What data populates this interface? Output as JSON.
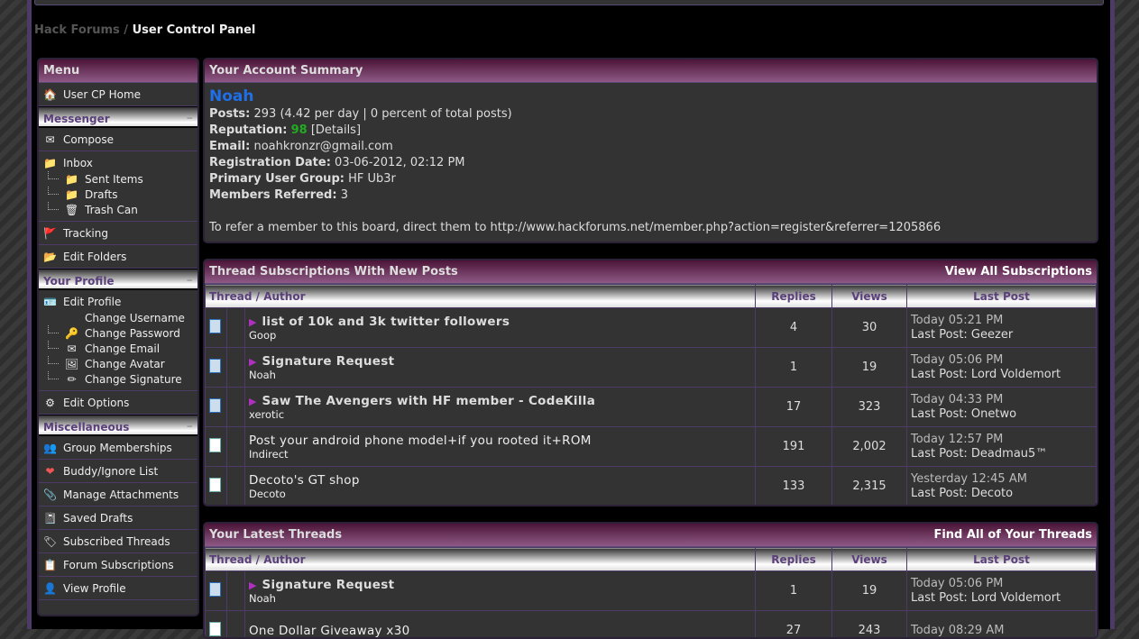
{
  "breadcrumb": {
    "root": "Hack Forums",
    "sep": " / ",
    "current": "User Control Panel"
  },
  "sidebar": {
    "title": "Menu",
    "home": "User CP Home",
    "messenger": {
      "title": "Messenger",
      "items": [
        "Compose",
        "Inbox",
        "Sent Items",
        "Drafts",
        "Trash Can",
        "Tracking",
        "Edit Folders"
      ]
    },
    "profile": {
      "title": "Your Profile",
      "items": [
        "Edit Profile",
        "Change Username",
        "Change Password",
        "Change Email",
        "Change Avatar",
        "Change Signature",
        "Edit Options"
      ]
    },
    "misc": {
      "title": "Miscellaneous",
      "items": [
        "Group Memberships",
        "Buddy/Ignore List",
        "Manage Attachments",
        "Saved Drafts",
        "Subscribed Threads",
        "Forum Subscriptions",
        "View Profile"
      ]
    },
    "collapse": "−"
  },
  "summary": {
    "title": "Your Account Summary",
    "username": "Noah",
    "posts_label": "Posts:",
    "posts": "293",
    "posts_extra": " (4.42 per day | 0 percent of total posts)",
    "rep_label": "Reputation:",
    "rep": "98",
    "rep_details": "[Details]",
    "email_label": "Email:",
    "email": "noahkronzr@gmail.com",
    "reg_label": "Registration Date:",
    "reg": "03-06-2012, 02:12 PM",
    "group_label": "Primary User Group:",
    "group": "HF Ub3r",
    "ref_label": "Members Referred:",
    "ref": "3",
    "refer_text": "To refer a member to this board, direct them to http://www.hackforums.net/member.php?action=register&referrer=1205866"
  },
  "columns": {
    "thread": "Thread / Author",
    "replies": "Replies",
    "views": "Views",
    "lastpost": "Last Post"
  },
  "subscriptions": {
    "title": "Thread Subscriptions With New Posts",
    "link": "View All Subscriptions",
    "rows": [
      {
        "title": "list of 10k and 3k twitter followers",
        "author": "Goop",
        "replies": "4",
        "views": "30",
        "time": "Today 05:21 PM",
        "last": "Last Post: Geezer",
        "new": true
      },
      {
        "title": "Signature Request",
        "author": "Noah",
        "replies": "1",
        "views": "19",
        "time": "Today 05:06 PM",
        "last": "Last Post: Lord Voldemort",
        "new": true
      },
      {
        "title": "Saw The Avengers with HF member - CodeKilla",
        "author": "xerotic",
        "replies": "17",
        "views": "323",
        "time": "Today 04:33 PM",
        "last": "Last Post: Onetwo",
        "new": true
      },
      {
        "title": "Post your android phone model+if you rooted it+ROM",
        "author": "Indirect",
        "replies": "191",
        "views": "2,002",
        "time": "Today 12:57 PM",
        "last": "Last Post: Deadmau5™",
        "new": false
      },
      {
        "title": "Decoto's GT shop",
        "author": "Decoto",
        "replies": "133",
        "views": "2,315",
        "time": "Yesterday 12:45 AM",
        "last": "Last Post: Decoto",
        "new": false
      }
    ]
  },
  "latest": {
    "title": "Your Latest Threads",
    "link": "Find All of Your Threads",
    "rows": [
      {
        "title": "Signature Request",
        "author": "Noah",
        "replies": "1",
        "views": "19",
        "time": "Today 05:06 PM",
        "last": "Last Post: Lord Voldemort",
        "new": true
      },
      {
        "title": "One Dollar Giveaway x30",
        "author": "",
        "replies": "27",
        "views": "243",
        "time": "Today 08:29 AM",
        "last": "",
        "new": false
      }
    ]
  }
}
